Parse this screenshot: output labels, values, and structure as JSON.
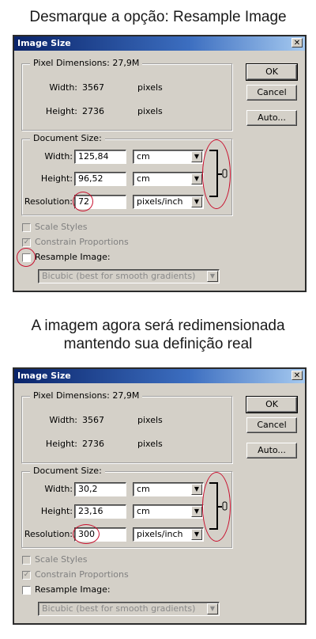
{
  "captions": {
    "top": "Desmarque a opção: Resample Image",
    "middle_line1": "A imagem agora será redimensionada",
    "middle_line2": "mantendo sua definição real"
  },
  "dialogs": [
    {
      "title": "Image Size",
      "close_glyph": "✕",
      "pixel_dimensions": {
        "legend": "Pixel Dimensions:  27,9M",
        "width_label": "Width:",
        "width_value": "3567",
        "width_unit": "pixels",
        "height_label": "Height:",
        "height_value": "2736",
        "height_unit": "pixels"
      },
      "document_size": {
        "legend": "Document Size:",
        "width_label": "Width:",
        "width_value": "125,84",
        "width_unit": "cm",
        "height_label": "Height:",
        "height_value": "96,52",
        "height_unit": "cm",
        "resolution_label": "Resolution:",
        "resolution_value": "72",
        "resolution_unit": "pixels/inch"
      },
      "buttons": {
        "ok": "OK",
        "cancel": "Cancel",
        "auto": "Auto..."
      },
      "options": {
        "scale_styles": "Scale Styles",
        "constrain_proportions": "Constrain Proportions",
        "resample_image": "Resample Image:",
        "resample_checked": false,
        "resample_method": "Bicubic (best for smooth gradients)"
      },
      "link_icon": "chain-link-icon"
    },
    {
      "title": "Image Size",
      "close_glyph": "✕",
      "pixel_dimensions": {
        "legend": "Pixel Dimensions:  27,9M",
        "width_label": "Width:",
        "width_value": "3567",
        "width_unit": "pixels",
        "height_label": "Height:",
        "height_value": "2736",
        "height_unit": "pixels"
      },
      "document_size": {
        "legend": "Document Size:",
        "width_label": "Width:",
        "width_value": "30,2",
        "width_unit": "cm",
        "height_label": "Height:",
        "height_value": "23,16",
        "height_unit": "cm",
        "resolution_label": "Resolution:",
        "resolution_value": "300",
        "resolution_unit": "pixels/inch"
      },
      "buttons": {
        "ok": "OK",
        "cancel": "Cancel",
        "auto": "Auto..."
      },
      "options": {
        "scale_styles": "Scale Styles",
        "constrain_proportions": "Constrain Proportions",
        "resample_image": "Resample Image:",
        "resample_checked": false,
        "resample_method": "Bicubic (best for smooth gradients)"
      },
      "link_icon": "chain-link-icon"
    }
  ],
  "colors": {
    "title_bar": "#0a246a",
    "dialog_face": "#d4d0c8",
    "highlight_red": "#c8102e"
  }
}
